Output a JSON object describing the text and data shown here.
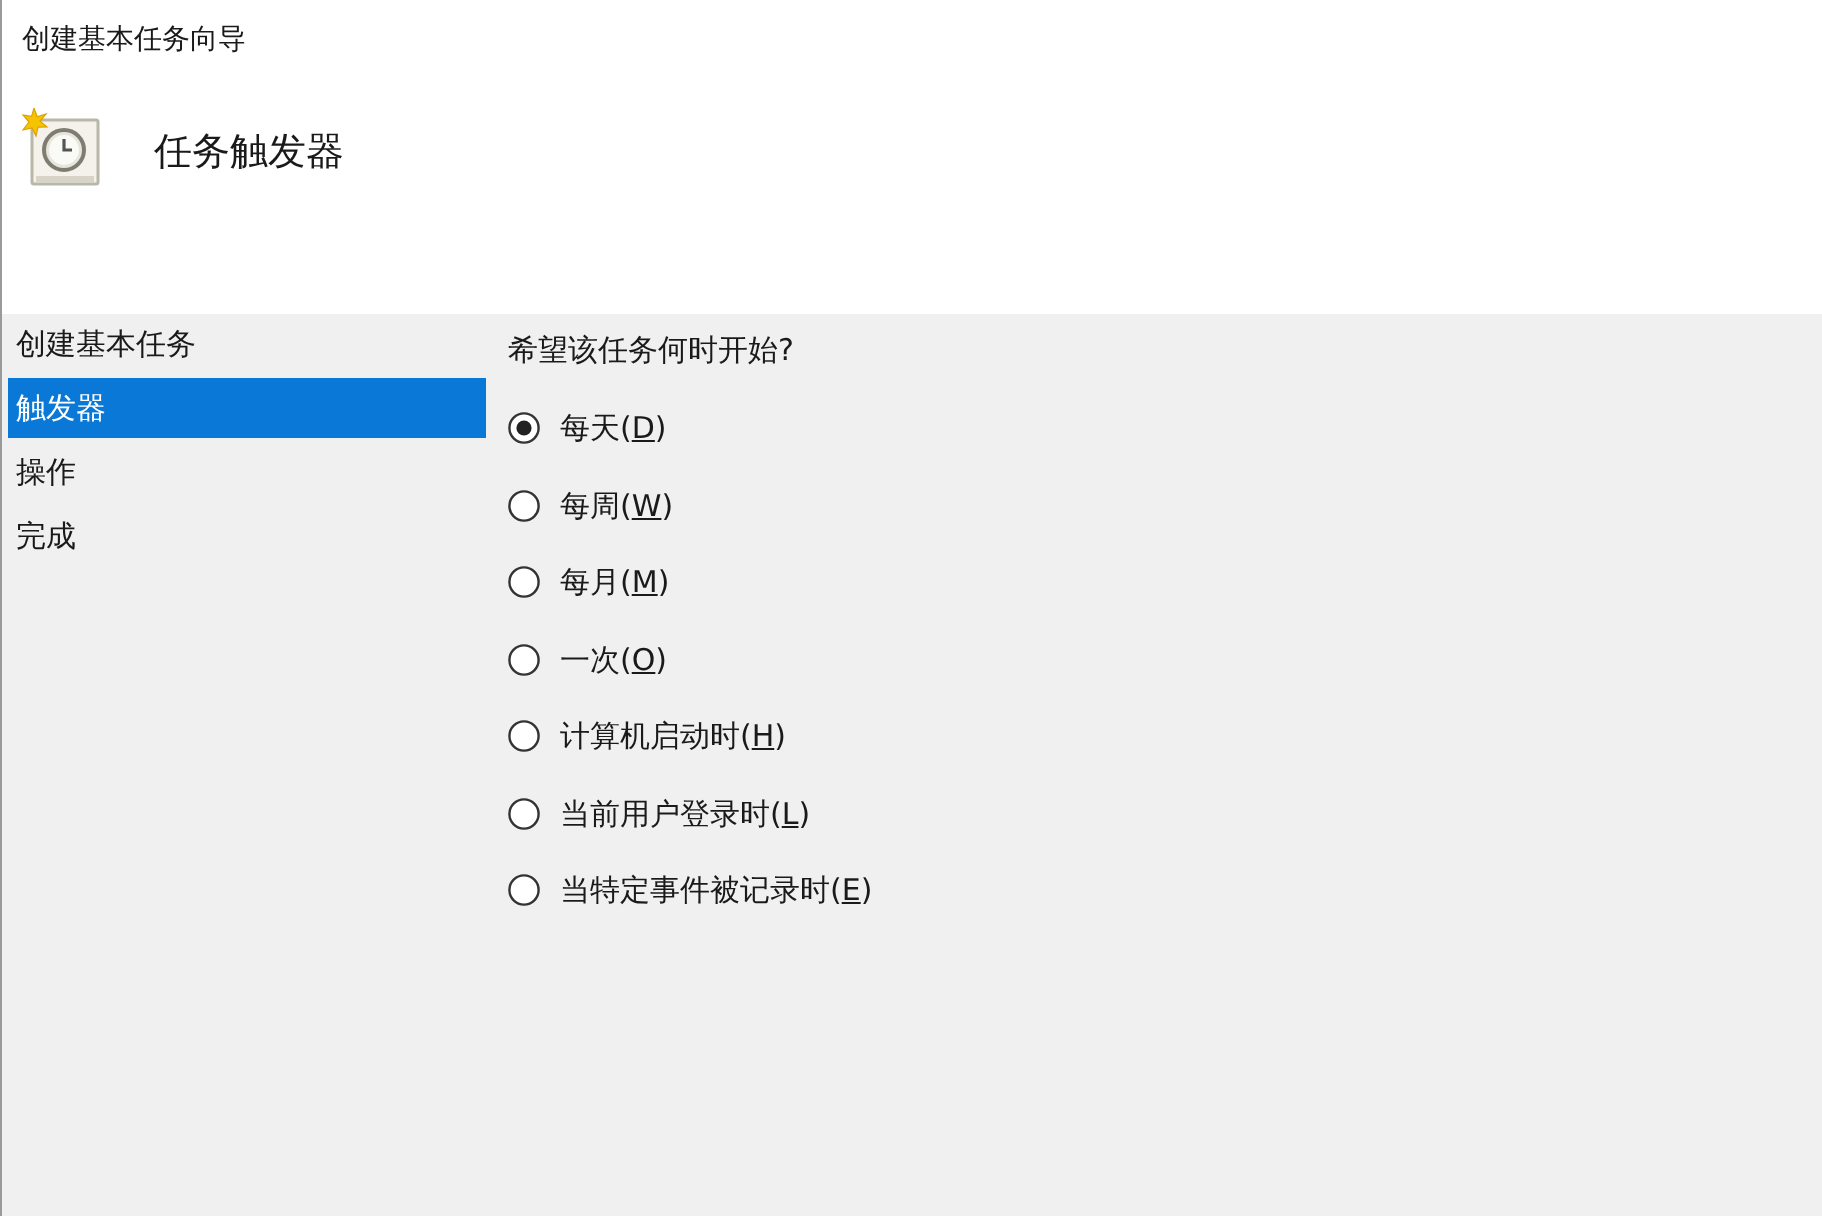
{
  "window": {
    "title": "创建基本任务向导"
  },
  "header": {
    "title": "任务触发器"
  },
  "steps": [
    {
      "label": "创建基本任务",
      "selected": false
    },
    {
      "label": "触发器",
      "selected": true
    },
    {
      "label": "操作",
      "selected": false
    },
    {
      "label": "完成",
      "selected": false
    }
  ],
  "question": "希望该任务何时开始?",
  "options": [
    {
      "label": "每天(D)",
      "selected": true
    },
    {
      "label": "每周(W)",
      "selected": false
    },
    {
      "label": "每月(M)",
      "selected": false
    },
    {
      "label": "一次(O)",
      "selected": false
    },
    {
      "label": "计算机启动时(H)",
      "selected": false
    },
    {
      "label": "当前用户登录时(L)",
      "selected": false
    },
    {
      "label": "当特定事件被记录时(E)",
      "selected": false
    }
  ]
}
